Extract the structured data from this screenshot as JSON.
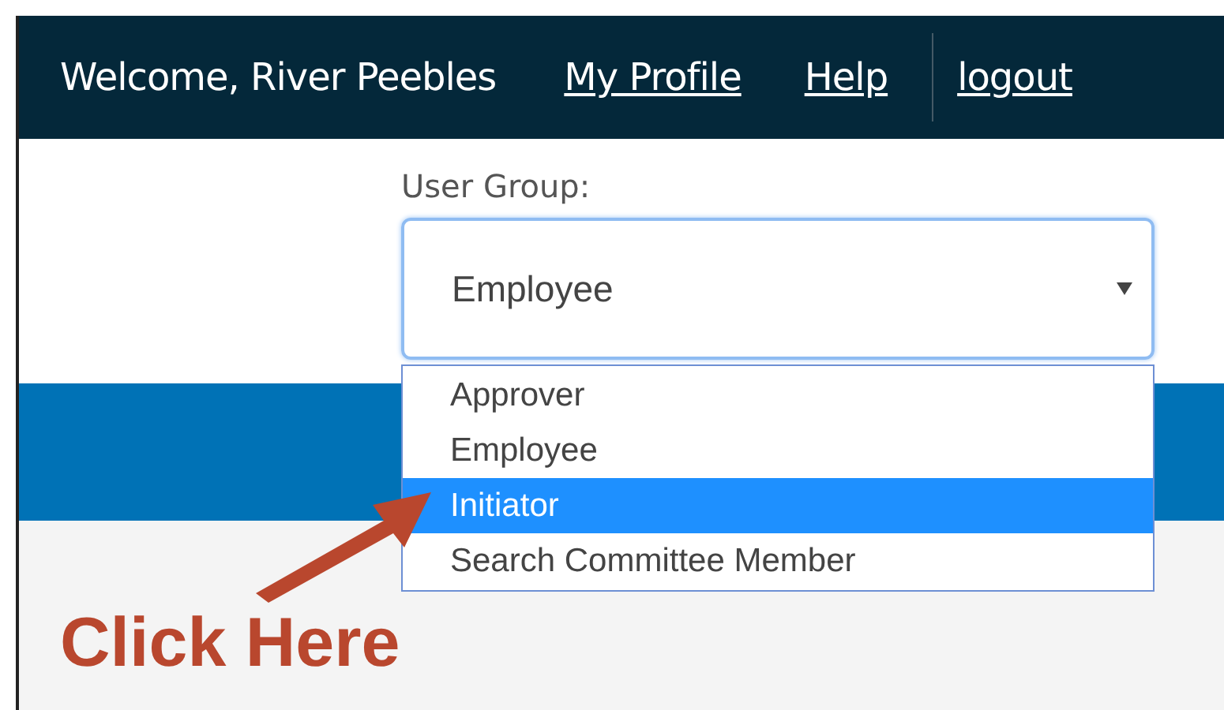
{
  "header": {
    "welcome": "Welcome, River Peebles",
    "links": [
      {
        "label": "My Profile",
        "kind": "plain"
      },
      {
        "label": "Help",
        "kind": "plain"
      },
      {
        "label": "logout",
        "kind": "divided"
      }
    ]
  },
  "user_group": {
    "label": "User Group:",
    "value": "Employee",
    "expanded": true,
    "options": [
      {
        "label": "Approver",
        "highlighted": false
      },
      {
        "label": "Employee",
        "highlighted": false
      },
      {
        "label": "Initiator",
        "highlighted": true
      },
      {
        "label": "Search Committee Member",
        "highlighted": false
      }
    ]
  },
  "annotation": {
    "text": "Click Here"
  }
}
